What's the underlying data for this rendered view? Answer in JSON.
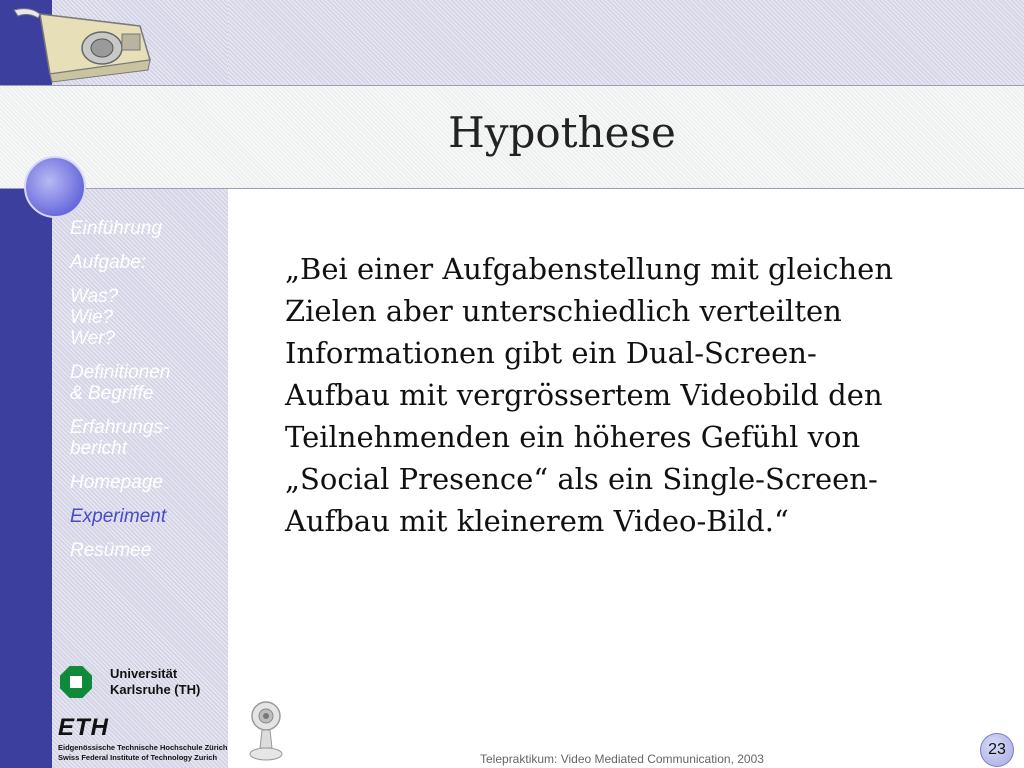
{
  "title": "Hypothese",
  "sidebar": {
    "items": [
      {
        "label": "Einführung"
      },
      {
        "label": "Aufgabe:"
      },
      {
        "label": "Was?\nWie?\nWer?"
      },
      {
        "label": "Definitionen\n& Begriffe"
      },
      {
        "label": "Erfahrungs-\nbericht"
      },
      {
        "label": "Homepage"
      },
      {
        "label": "Experiment",
        "active": true
      },
      {
        "label": "Resümee"
      }
    ]
  },
  "logos": {
    "university": "Universität\nKarlsruhe (TH)",
    "eth": "ETH",
    "eth_line1": "Eidgenössische Technische Hochschule Zürich",
    "eth_line2": "Swiss Federal Institute of Technology Zurich"
  },
  "body": {
    "text": "„Bei einer Aufgabenstellung mit gleichen Zielen aber unterschiedlich verteilten Informationen gibt ein Dual-Screen-Aufbau mit vergrössertem Videobild den Teilnehmenden ein höheres Gefühl von „Social Presence“ als ein Single-Screen-Aufbau mit kleinerem Video-Bild.“"
  },
  "footer": {
    "text": "Telepraktikum: Video Mediated Communication, 2003",
    "page_number": "23"
  },
  "colors": {
    "accent": "#3d3f9e",
    "active_nav": "#4a4bc8",
    "uni_green": "#0f8a3b"
  }
}
